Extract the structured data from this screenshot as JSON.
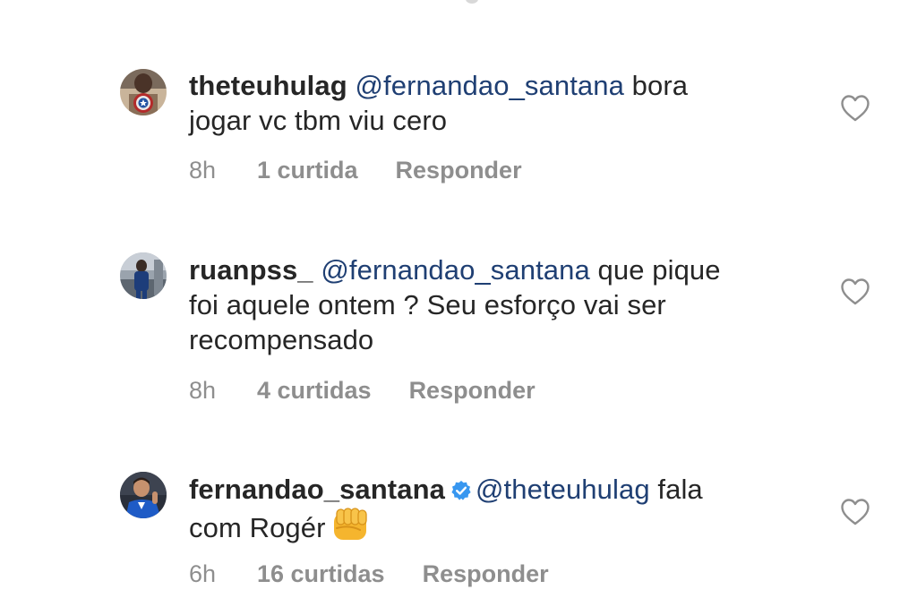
{
  "comments": [
    {
      "username": "theteuhulag",
      "verified": false,
      "mention": "@fernandao_santana",
      "text_line1": " bora",
      "text_rest": "jogar vc tbm viu cero",
      "time": "8h",
      "likes": "1 curtida",
      "reply": "Responder",
      "avatar_icon": "avatar-captain-shield",
      "like_icon": "heart-outline-icon"
    },
    {
      "username": "ruanpss_",
      "verified": false,
      "mention": "@fernandao_santana",
      "text_line1": " que pique",
      "text_rest": "foi aquele ontem ? Seu esforço vai ser recompensado",
      "time": "8h",
      "likes": "4 curtidas",
      "reply": "Responder",
      "avatar_icon": "avatar-photo",
      "like_icon": "heart-outline-icon"
    },
    {
      "username": "fernandao_santana",
      "verified": true,
      "mention": "@theteuhulag",
      "text_line1": " fala",
      "text_rest": "com Rogér",
      "emoji": "oncoming-fist-emoji",
      "time": "6h",
      "likes": "16 curtidas",
      "reply": "Responder",
      "avatar_icon": "avatar-player-photo",
      "like_icon": "heart-outline-icon"
    }
  ],
  "colors": {
    "text": "#262626",
    "mention": "#1f3f73",
    "meta": "#8e8e8e",
    "verified": "#3897f0"
  }
}
